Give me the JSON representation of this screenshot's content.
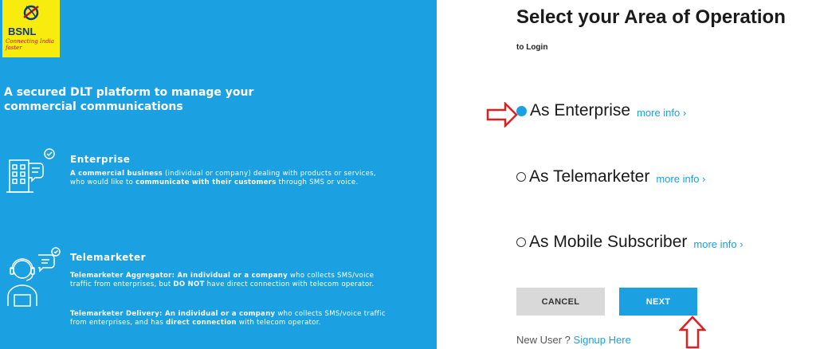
{
  "brand": {
    "name": "BSNL",
    "tagline": "Connecting India faster",
    "colors": {
      "panel": "#1ba1e2",
      "logo_bg": "#f8eb0e",
      "accent": "#1ba1e2",
      "annotation": "#e02020"
    }
  },
  "left_panel": {
    "headline": "A secured DLT platform to manage your commercial communications",
    "enterprise": {
      "icon": "building-chat-icon",
      "title": "Enterprise",
      "desc_bold1": "A commercial business",
      "desc_text1": " (individual or company) dealing with products or services, who would like to ",
      "desc_bold2": "communicate with their customers",
      "desc_text2": " through SMS or voice."
    },
    "telemarketer": {
      "icon": "headset-agent-icon",
      "title": "Telemarketer",
      "agg_bold1": "Telemarketer Aggregator: An individual or a company",
      "agg_text1": " who collects SMS/voice traffic from enterprises, but ",
      "agg_bold2": "DO NOT",
      "agg_text2": " have direct connection with telecom operator.",
      "del_bold1": "Telemarketer Delivery: An individual or a company",
      "del_text1": " who collects SMS/voice traffic from enterprises, and has ",
      "del_bold2": "direct connection",
      "del_text2": " with telecom operator."
    }
  },
  "form": {
    "title": "Select your Area of Operation",
    "subtitle": "to Login",
    "options": [
      {
        "label": "As Enterprise",
        "more": "more info ›",
        "selected": true
      },
      {
        "label": "As Telemarketer",
        "more": "more info ›",
        "selected": false
      },
      {
        "label": "As Mobile Subscriber",
        "more": "more info ›",
        "selected": false
      }
    ],
    "cancel_label": "CANCEL",
    "next_label": "NEXT",
    "new_user_text": "New User ? ",
    "signup_link": "Signup Here"
  }
}
